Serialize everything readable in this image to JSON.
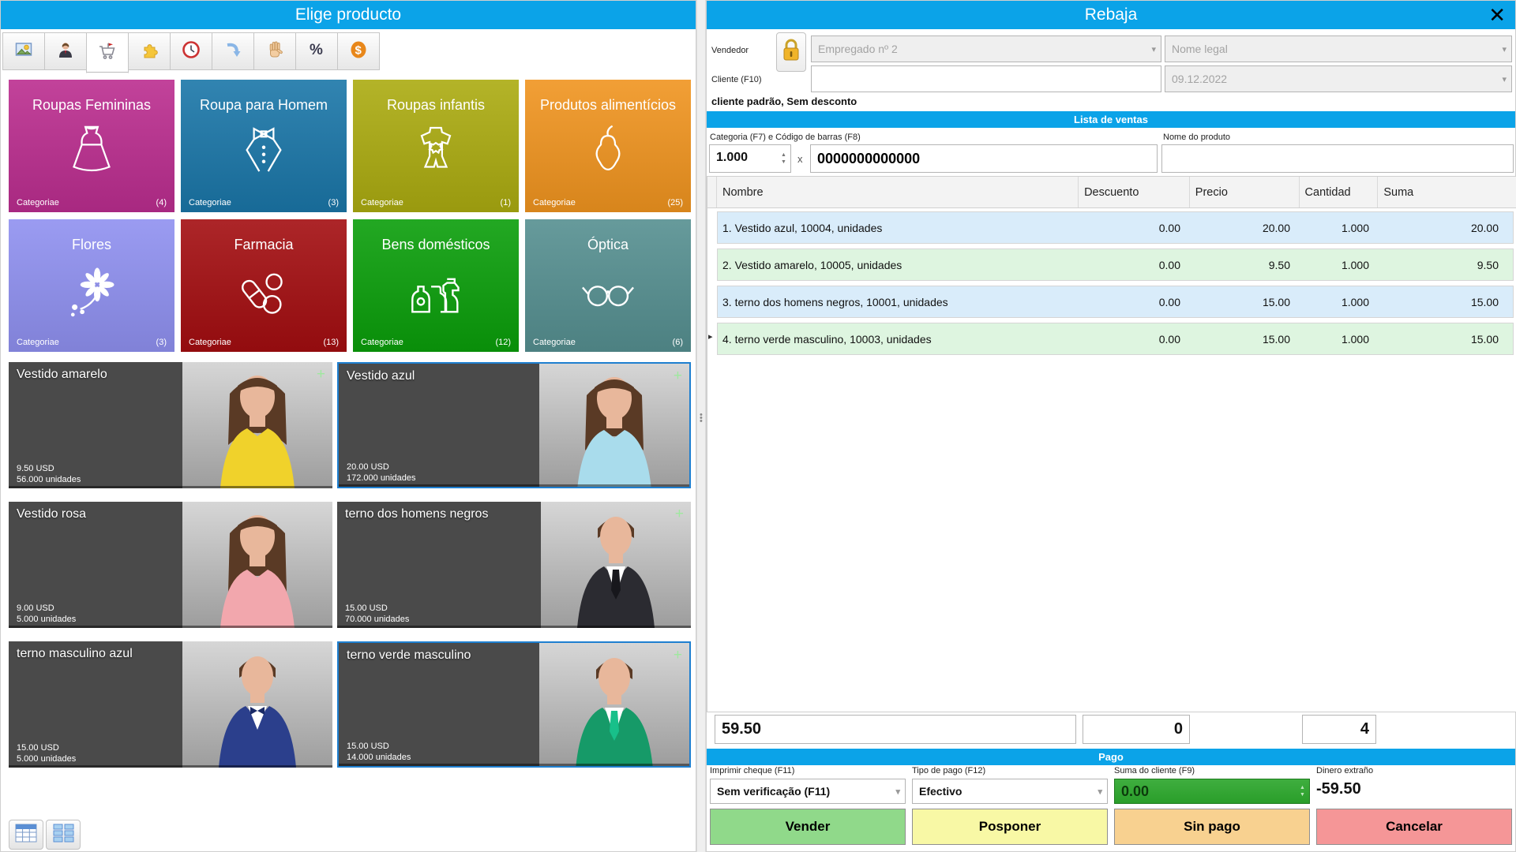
{
  "accent_color": "#0ba3e8",
  "left_panel": {
    "title": "Elige producto",
    "toolbar": {
      "buttons": [
        "pictures",
        "person",
        "cart",
        "puzzle",
        "clock",
        "undo-arrow",
        "hand",
        "percent",
        "dollar"
      ]
    },
    "categories": [
      {
        "name": "Roupas Femininas",
        "footer": "Categoriae",
        "count": "(4)",
        "color": "#bb2d8f"
      },
      {
        "name": "Roupa para Homem",
        "footer": "Categoriae",
        "count": "(3)",
        "color": "#1a76a8"
      },
      {
        "name": "Roupas infantis",
        "footer": "Categoriae",
        "count": "(1)",
        "color": "#abab10"
      },
      {
        "name": "Produtos alimentícios",
        "footer": "Categoriae",
        "count": "(25)",
        "color": "#f0941f"
      },
      {
        "name": "Flores",
        "footer": "Categoriae",
        "count": "(3)",
        "color": "#8f90f0"
      },
      {
        "name": "Farmacia",
        "footer": "Categoriae",
        "count": "(13)",
        "color": "#a30d10"
      },
      {
        "name": "Bens domésticos",
        "footer": "Categoriae",
        "count": "(12)",
        "color": "#0a9e0a"
      },
      {
        "name": "Óptica",
        "footer": "Categoriae",
        "count": "(6)",
        "color": "#558f90"
      }
    ],
    "products": [
      {
        "name": "Vestido amarelo",
        "price": "9.50 USD",
        "stock": "56.000 unidades",
        "plus": "+",
        "selected": false
      },
      {
        "name": "Vestido azul",
        "price": "20.00 USD",
        "stock": "172.000 unidades",
        "plus": "+",
        "selected": true
      },
      {
        "name": "Vestido rosa",
        "price": "9.00 USD",
        "stock": "5.000 unidades",
        "plus": "",
        "selected": false
      },
      {
        "name": "terno dos homens negros",
        "price": "15.00 USD",
        "stock": "70.000 unidades",
        "plus": "+",
        "selected": false
      },
      {
        "name": "terno masculino azul",
        "price": "15.00 USD",
        "stock": "5.000 unidades",
        "plus": "",
        "selected": false
      },
      {
        "name": "terno verde masculino",
        "price": "15.00 USD",
        "stock": "14.000 unidades",
        "plus": "+",
        "selected": true
      }
    ]
  },
  "right_panel": {
    "title": "Rebaja",
    "close_label": "✕",
    "form": {
      "vendedor_label": "Vendedor",
      "vendedor_value": "Empregado nº 2",
      "nome_legal_value": "Nome legal",
      "cliente_label": "Cliente (F10)",
      "cliente_value": "",
      "date_value": "09.12.2022",
      "status_line": "cliente padrão, Sem desconto"
    },
    "lista_header": "Lista de ventas",
    "entry": {
      "categoria_label": "Categoria (F7) e Código de barras (F8)",
      "nome_produto_label": "Nome do produto",
      "qty_value": "1.000",
      "multiply_label": "x",
      "barcode_value": "0000000000000",
      "nome_produto_value": ""
    },
    "table": {
      "columns": [
        "Nombre",
        "Descuento",
        "Precio",
        "Cantidad",
        "Suma"
      ],
      "current_row_marker": "▸",
      "rows": [
        {
          "nombre": "1. Vestido azul, 10004, unidades",
          "descuento": "0.00",
          "precio": "20.00",
          "cantidad": "1.000",
          "suma": "20.00"
        },
        {
          "nombre": "2. Vestido amarelo, 10005, unidades",
          "descuento": "0.00",
          "precio": "9.50",
          "cantidad": "1.000",
          "suma": "9.50"
        },
        {
          "nombre": "3. terno dos homens negros, 10001, unidades",
          "descuento": "0.00",
          "precio": "15.00",
          "cantidad": "1.000",
          "suma": "15.00"
        },
        {
          "nombre": "4. terno verde masculino, 10003, unidades",
          "descuento": "0.00",
          "precio": "15.00",
          "cantidad": "1.000",
          "suma": "15.00"
        }
      ]
    },
    "totals": {
      "total": "59.50",
      "discount": "0",
      "item_count": "4"
    },
    "pago_header": "Pago",
    "payment": {
      "imprimir_label": "Imprimir cheque (F11)",
      "imprimir_value": "Sem verificação (F11)",
      "tipo_label": "Tipo de pago (F12)",
      "tipo_value": "Efectivo",
      "suma_label": "Suma do cliente (F9)",
      "suma_value": "0.00",
      "dinero_label": "Dinero extraño",
      "dinero_value": "-59.50"
    },
    "actions": [
      {
        "label": "Vender",
        "color": "#90d98a"
      },
      {
        "label": "Posponer",
        "color": "#f8f8a5"
      },
      {
        "label": "Sin pago",
        "color": "#f8d190"
      },
      {
        "label": "Cancelar",
        "color": "#f59697"
      }
    ]
  }
}
